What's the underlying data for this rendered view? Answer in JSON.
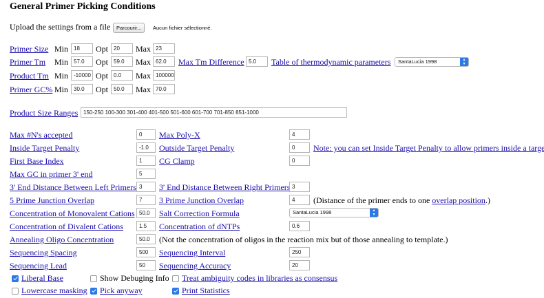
{
  "title": "General Primer Picking Conditions",
  "upload": {
    "label": "Upload the settings from a file",
    "button": "Parcourir...",
    "status": "Aucun fichier sélectionné."
  },
  "primer_size": {
    "label": "Primer Size",
    "min_label": "Min",
    "min": "18",
    "opt_label": "Opt",
    "opt": "20",
    "max_label": "Max",
    "max": "23"
  },
  "primer_tm": {
    "label": "Primer Tm",
    "min_label": "Min",
    "min": "57.0",
    "opt_label": "Opt",
    "opt": "59.0",
    "max_label": "Max",
    "max": "62.0",
    "diff_label": "Max Tm Difference",
    "diff": "5.0",
    "table_label": "Table of thermodynamic parameters",
    "table_value": "SantaLucia 1998"
  },
  "product_tm": {
    "label": "Product Tm",
    "min_label": "Min",
    "min": "-10000",
    "opt_label": "Opt",
    "opt": "0.0",
    "max_label": "Max",
    "max": "1000000"
  },
  "primer_gc": {
    "label": "Primer GC%",
    "min_label": "Min",
    "min": "30.0",
    "opt_label": "Opt",
    "opt": "50.0",
    "max_label": "Max",
    "max": "70.0"
  },
  "product_size_ranges": {
    "label": "Product Size Ranges",
    "value": "150-250 100-300 301-400 401-500 501-600 601-700 701-850 851-1000"
  },
  "params": {
    "max_ns_label": "Max #N's accepted",
    "max_ns": "0",
    "max_polyx_label": "Max Poly-X",
    "max_polyx": "4",
    "inside_penalty_label": "Inside Target Penalty",
    "inside_penalty": "-1.0",
    "outside_penalty_label": "Outside Target Penalty",
    "outside_penalty": "0",
    "note_label": "Note: you can set Inside Target Penalty to allow primers inside a target.",
    "first_base_label": "First Base Index",
    "first_base": "1",
    "cg_clamp_label": "CG Clamp",
    "cg_clamp": "0",
    "max_gc3_label": "Max GC in primer 3' end",
    "max_gc3": "5",
    "end_dist_left_label": "3' End Distance Between Left Primers",
    "end_dist_left": "3",
    "end_dist_right_label": "3' End Distance Between Right Primers",
    "end_dist_right": "3",
    "junction5_label": "5 Prime Junction Overlap",
    "junction5": "7",
    "junction3_label": "3 Prime Junction Overlap",
    "junction3": "4",
    "junction_note_pre": "(Distance of the primer ends to one",
    "junction_note_link": "overlap position",
    "junction_note_post": ".)",
    "mono_label": "Concentration of Monovalent Cations",
    "mono": "50.0",
    "salt_label": "Salt Correction Formula",
    "salt_value": "SantaLucia 1998",
    "div_label": "Concentration of Divalent Cations",
    "div": "1.5",
    "dntp_label": "Concentration of dNTPs",
    "dntp": "0.6",
    "anneal_label": "Annealing Oligo Concentration",
    "anneal": "50.0",
    "anneal_note": "(Not the concentration of oligos in the reaction mix but of those annealing to template.)",
    "seq_spacing_label": "Sequencing Spacing",
    "seq_spacing": "500",
    "seq_interval_label": "Sequencing Interval",
    "seq_interval": "250",
    "seq_lead_label": "Sequencing Lead",
    "seq_lead": "50",
    "seq_accuracy_label": "Sequencing Accuracy",
    "seq_accuracy": "20"
  },
  "checkboxes": {
    "liberal_base": {
      "label": "Liberal Base",
      "checked": true
    },
    "show_debug": {
      "label": "Show Debuging Info",
      "checked": false
    },
    "ambiguity": {
      "label": "Treat ambiguity codes in libraries as consensus",
      "checked": false
    },
    "lowercase": {
      "label": "Lowercase masking",
      "checked": false
    },
    "pick_anyway": {
      "label": "Pick anyway",
      "checked": true
    },
    "print_stats": {
      "label": "Print Statistics",
      "checked": true
    }
  },
  "colors": {
    "link": "#1a0dab",
    "select_arrow": "#2b79e6",
    "checkbox_on": "#2b79e6"
  }
}
